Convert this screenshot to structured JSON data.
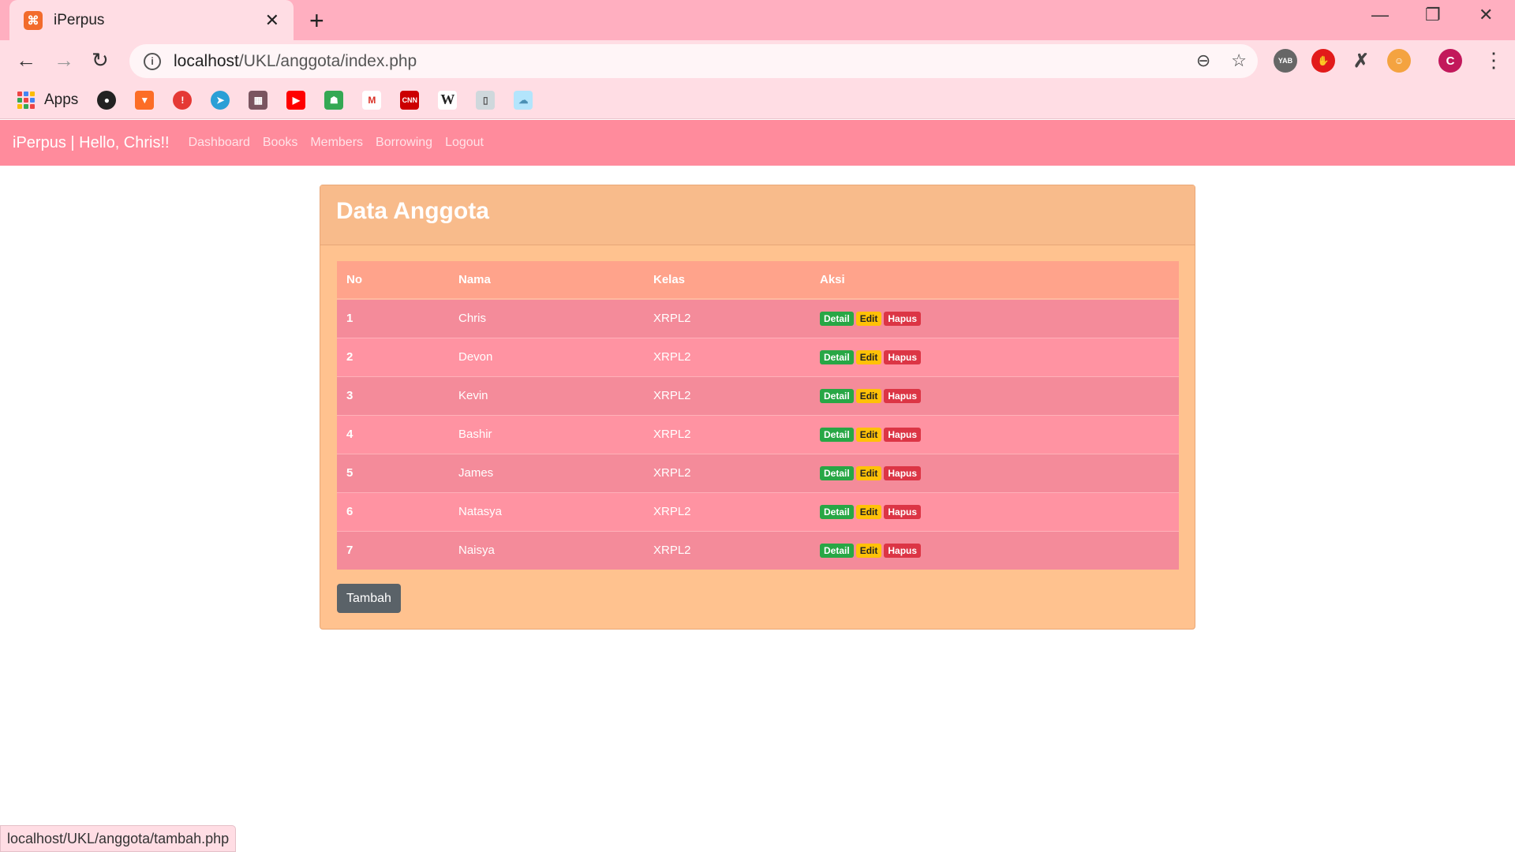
{
  "browser": {
    "tab_title": "iPerpus",
    "tab_icon": "xampp-icon",
    "url_host": "localhost",
    "url_path": "/UKL/anggota/index.php",
    "profile_initial": "C",
    "extension_yab": "YAB",
    "bookmarks": {
      "apps_label": "Apps",
      "items": [
        "github-icon",
        "gitlab-icon",
        "alert-icon",
        "telegram-icon",
        "photo-icon",
        "youtube-icon",
        "classroom-icon",
        "gmail-icon",
        "cnn-icon",
        "wikipedia-icon",
        "book-icon",
        "cloud-icon"
      ],
      "cnn_label": "CNN",
      "wiki_label": "W"
    },
    "status_url": "localhost/UKL/anggota/tambah.php"
  },
  "navbar": {
    "brand": "iPerpus | Hello, Chris!!",
    "links": [
      "Dashboard",
      "Books",
      "Members",
      "Borrowing",
      "Logout"
    ]
  },
  "card": {
    "title": "Data Anggota",
    "table": {
      "headers": [
        "No",
        "Nama",
        "Kelas",
        "Aksi"
      ],
      "rows": [
        {
          "no": "1",
          "nama": "Chris",
          "kelas": "XRPL2"
        },
        {
          "no": "2",
          "nama": "Devon",
          "kelas": "XRPL2"
        },
        {
          "no": "3",
          "nama": "Kevin",
          "kelas": "XRPL2"
        },
        {
          "no": "4",
          "nama": "Bashir",
          "kelas": "XRPL2"
        },
        {
          "no": "5",
          "nama": "James",
          "kelas": "XRPL2"
        },
        {
          "no": "6",
          "nama": "Natasya",
          "kelas": "XRPL2"
        },
        {
          "no": "7",
          "nama": "Naisya",
          "kelas": "XRPL2"
        }
      ],
      "actions": {
        "detail": "Detail",
        "edit": "Edit",
        "hapus": "Hapus"
      }
    },
    "add_button": "Tambah"
  },
  "colors": {
    "navbar": "#ff8b9c",
    "card": "#ffc28f",
    "badge_detail": "#28a745",
    "badge_edit": "#ffc107",
    "badge_hapus": "#dc3545"
  }
}
